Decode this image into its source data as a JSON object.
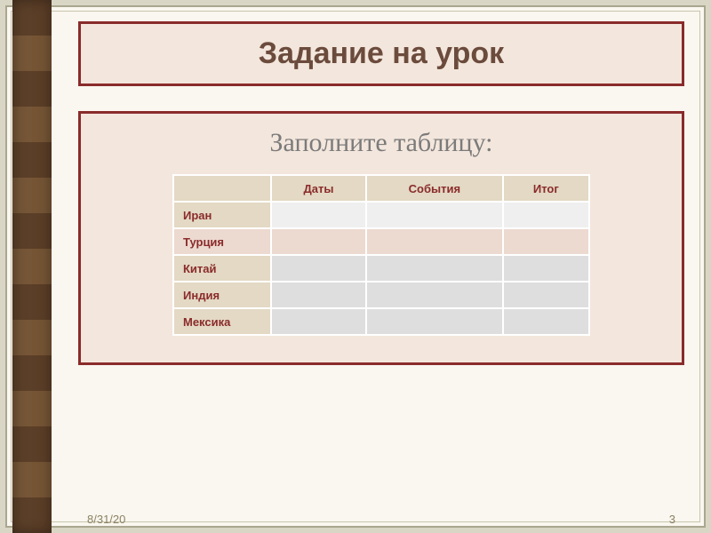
{
  "title": "Задание на урок",
  "subtitle": "Заполните таблицу:",
  "table": {
    "columns": [
      "",
      "Даты",
      "События",
      "Итог"
    ],
    "rows": [
      {
        "label": "Иран",
        "cells": [
          "",
          "",
          ""
        ]
      },
      {
        "label": "Турция",
        "cells": [
          "",
          "",
          ""
        ]
      },
      {
        "label": "Китай",
        "cells": [
          "",
          "",
          ""
        ]
      },
      {
        "label": "Индия",
        "cells": [
          "",
          "",
          ""
        ]
      },
      {
        "label": "Мексика",
        "cells": [
          "",
          "",
          ""
        ]
      }
    ]
  },
  "footer": {
    "date": "8/31/20",
    "page": "3"
  }
}
